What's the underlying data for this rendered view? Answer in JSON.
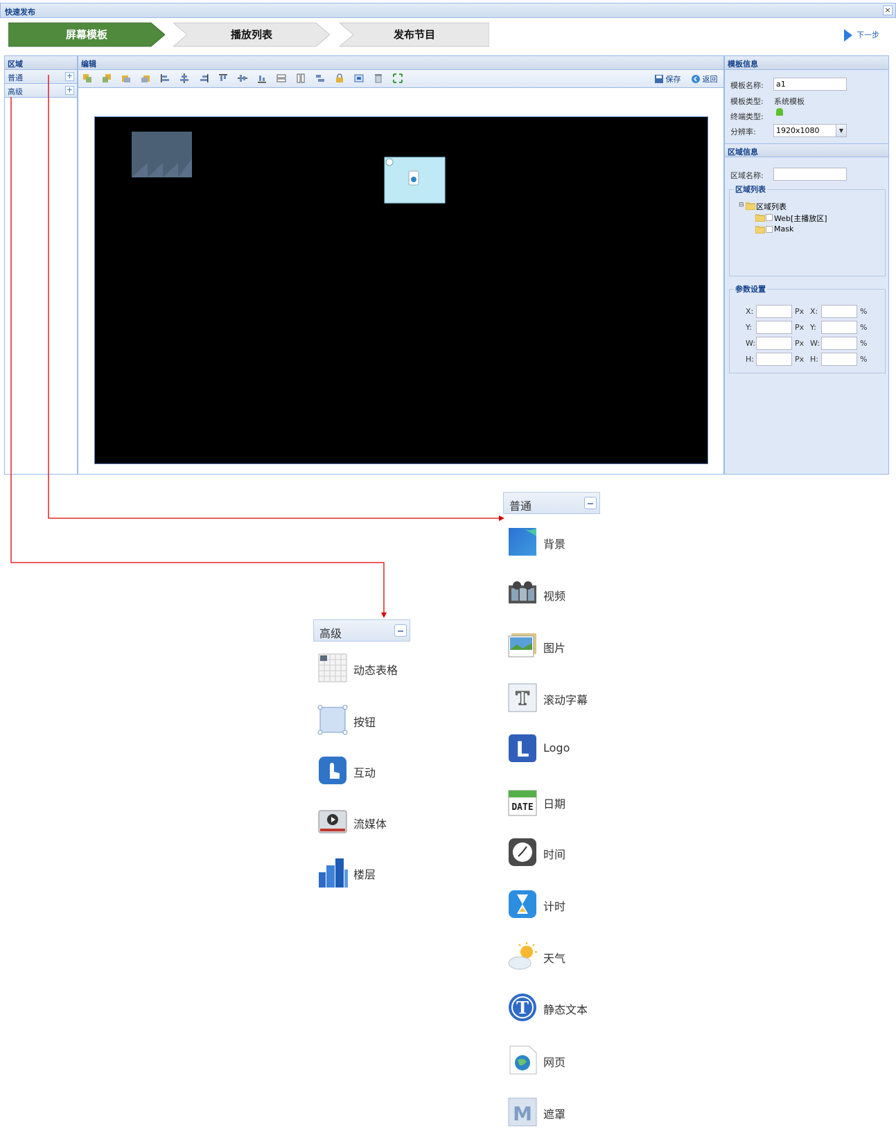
{
  "window": {
    "title": "快速发布",
    "close": "×"
  },
  "wizard": {
    "steps": [
      "屏幕模板",
      "播放列表",
      "发布节目"
    ],
    "next": "下一步"
  },
  "left_panel": {
    "title": "区域",
    "items": [
      "普通",
      "高级"
    ]
  },
  "editor": {
    "title": "编辑",
    "save": "保存",
    "back": "返回"
  },
  "template_info": {
    "title": "模板信息",
    "name_label": "模板名称:",
    "name_value": "a1",
    "type_label": "模板类型:",
    "type_value": "系统模板",
    "terminal_label": "终端类型:",
    "resolution_label": "分辨率:",
    "resolution_value": "1920x1080"
  },
  "area_info": {
    "title": "区域信息",
    "name_label": "区域名称:",
    "list_legend": "区域列表",
    "tree_root": "区域列表",
    "tree_items": [
      "Web[主播放区]",
      "Mask"
    ]
  },
  "params": {
    "legend": "参数设置",
    "rows": [
      {
        "label": "X:",
        "unit": "Px",
        "label2": "X:",
        "unit2": "%"
      },
      {
        "label": "Y:",
        "unit": "Px",
        "label2": "Y:",
        "unit2": "%"
      },
      {
        "label": "W:",
        "unit": "Px",
        "label2": "W:",
        "unit2": "%"
      },
      {
        "label": "H:",
        "unit": "Px",
        "label2": "H:",
        "unit2": "%"
      }
    ]
  },
  "callout_normal": {
    "title": "普通",
    "items": [
      "背景",
      "视频",
      "图片",
      "滚动字幕",
      "Logo",
      "日期",
      "时间",
      "计时",
      "天气",
      "静态文本",
      "网页",
      "遮罩"
    ]
  },
  "callout_advanced": {
    "title": "高级",
    "items": [
      "动态表格",
      "按钮",
      "互动",
      "流媒体",
      "楼层"
    ]
  },
  "icon_texts": {
    "date": "DATE",
    "logo": "L",
    "text": "T",
    "mask": "M"
  },
  "colors": {
    "accent": "#4a8a3a",
    "border": "#99bbe8",
    "arrow": "#d80000"
  }
}
